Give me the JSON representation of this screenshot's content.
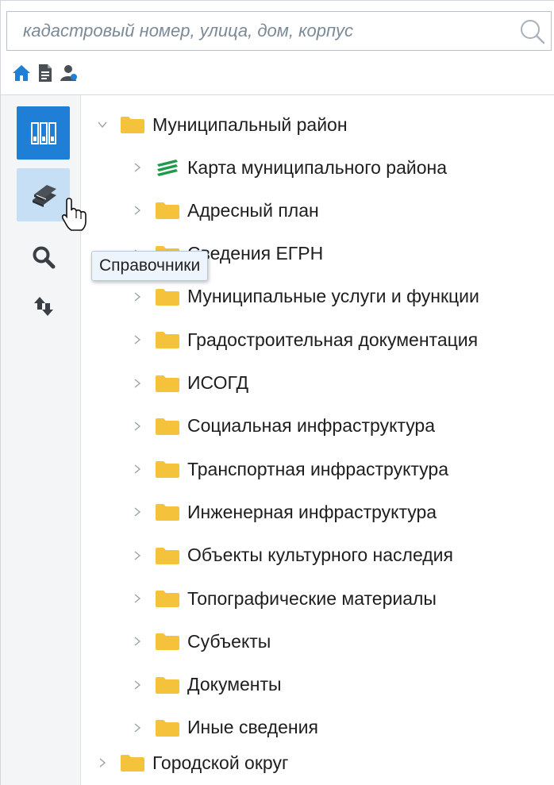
{
  "search": {
    "placeholder": "кадастровый номер, улица, дом, корпус",
    "value": ""
  },
  "mini_toolbar": [
    {
      "icon": "home-icon"
    },
    {
      "icon": "document-icon"
    },
    {
      "icon": "user-icon"
    }
  ],
  "sidebar": {
    "buttons": [
      {
        "icon": "layers-panel-icon",
        "state": "active"
      },
      {
        "icon": "books-icon",
        "state": "hover"
      },
      {
        "icon": "search-icon",
        "state": "normal"
      },
      {
        "icon": "swap-arrows-icon",
        "state": "normal"
      }
    ]
  },
  "tooltip": {
    "text": "Справочники"
  },
  "tree": {
    "root": {
      "label": "Муниципальный район",
      "expanded": true
    },
    "children": [
      {
        "label": "Карта муниципального района",
        "icon": "layers-icon"
      },
      {
        "label": "Адресный план",
        "icon": "folder-icon"
      },
      {
        "label": "Сведения ЕГРН",
        "icon": "folder-icon"
      },
      {
        "label": "Муниципальные услуги и функции",
        "icon": "folder-icon"
      },
      {
        "label": "Градостроительная документация",
        "icon": "folder-icon"
      },
      {
        "label": "ИСОГД",
        "icon": "folder-icon"
      },
      {
        "label": "Социальная инфраструктура",
        "icon": "folder-icon"
      },
      {
        "label": "Транспортная инфраструктура",
        "icon": "folder-icon"
      },
      {
        "label": "Инженерная инфраструктура",
        "icon": "folder-icon"
      },
      {
        "label": "Объекты культурного наследия",
        "icon": "folder-icon"
      },
      {
        "label": "Топографические материалы",
        "icon": "folder-icon"
      },
      {
        "label": "Субъекты",
        "icon": "folder-icon"
      },
      {
        "label": "Документы",
        "icon": "folder-icon"
      },
      {
        "label": "Иные сведения",
        "icon": "folder-icon"
      }
    ],
    "sibling": {
      "label": "Городской округ",
      "expanded": false
    }
  },
  "colors": {
    "accent": "#1f7fd6",
    "hover": "#c7dff5",
    "folder": "#f5c33b",
    "layers_green": "#1f9a4a"
  }
}
